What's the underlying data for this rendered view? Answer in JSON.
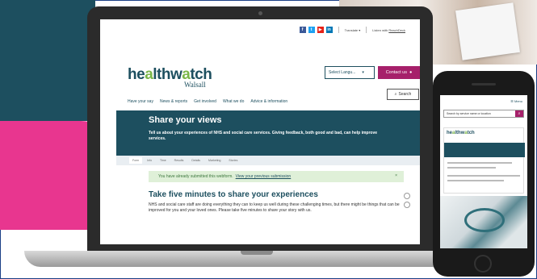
{
  "topbar": {
    "social": [
      "f",
      "t",
      "▶",
      "in"
    ],
    "translate": "Translate ▾",
    "listen": "Listen with",
    "listen_brand": "ReachDeck"
  },
  "header": {
    "logo_main_a": "he",
    "logo_accent_a": "a",
    "logo_main_b": "lthw",
    "logo_accent_b": "a",
    "logo_main_c": "tch",
    "logo_sub": "Walsall",
    "language": "Select Langu...",
    "contact": "Contact us",
    "search": "Search"
  },
  "nav": [
    "Have your say",
    "News & reports",
    "Get involved",
    "What we do",
    "Advice & information"
  ],
  "hero": {
    "title": "Share your views",
    "description": "Tell us about your experiences of NHS and social care services. Giving feedback, both good and bad, can help improve services."
  },
  "tabs": [
    "Form",
    "Info",
    "Time",
    "Results",
    "Details",
    "Marketing",
    "Stories"
  ],
  "notice": {
    "text": "You have already submitted this webform.",
    "link": "View your previous submission"
  },
  "main": {
    "title": "Take five minutes to share your experiences",
    "text": "NHS and social care staff are doing everything they can to keep us well during these challenging times, but there might be things that can be improved for you and your loved ones. Please take five minutes to share your story with us."
  },
  "phone": {
    "menu": "☰ Menu",
    "search_placeholder": "Search by service name or location"
  },
  "colors": {
    "brand_teal": "#1d4f5f",
    "brand_pink": "#e8368f",
    "contact_magenta": "#a6206a",
    "logo_green": "#7ab648"
  }
}
